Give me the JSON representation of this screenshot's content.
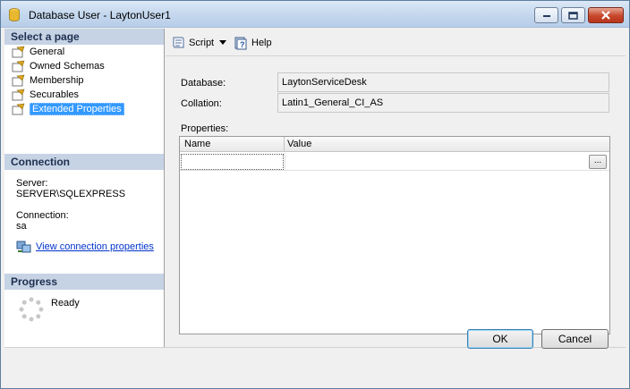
{
  "window": {
    "title": "Database User - LaytonUser1"
  },
  "left": {
    "select_page_header": "Select a page",
    "pages": [
      {
        "label": "General"
      },
      {
        "label": "Owned Schemas"
      },
      {
        "label": "Membership"
      },
      {
        "label": "Securables"
      },
      {
        "label": "Extended Properties"
      }
    ],
    "connection_header": "Connection",
    "server_label": "Server:",
    "server_value": "SERVER\\SQLEXPRESS",
    "connection_label": "Connection:",
    "connection_value": "sa",
    "view_link": "View connection properties",
    "progress_header": "Progress",
    "progress_status": "Ready"
  },
  "toolbar": {
    "script_label": "Script",
    "help_label": "Help"
  },
  "form": {
    "database_label": "Database:",
    "database_value": "LaytonServiceDesk",
    "collation_label": "Collation:",
    "collation_value": "Latin1_General_CI_AS",
    "properties_label": "Properties:",
    "columns": [
      "Name",
      "Value"
    ],
    "ellipsis_label": "..."
  },
  "buttons": {
    "ok_label": "OK",
    "cancel_label": "Cancel"
  }
}
